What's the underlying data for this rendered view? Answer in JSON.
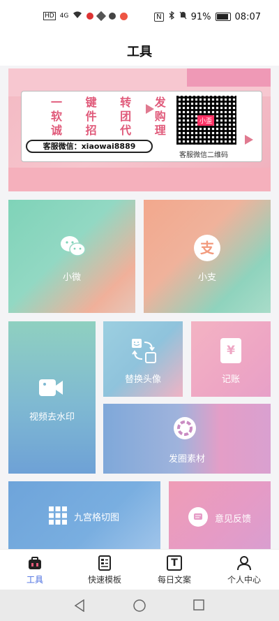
{
  "status_bar": {
    "left_icons": [
      "HD",
      "4G",
      "wifi-icon",
      "app-icon-1",
      "app-icon-2",
      "app-icon-3",
      "app-icon-4"
    ],
    "nfc_icon": "N",
    "battery": "91%",
    "time": "08:07"
  },
  "header": {
    "title": "工具"
  },
  "banner": {
    "slogan_lines": [
      "一 键 转 发",
      "软 件 团 购",
      "诚 招 代 理"
    ],
    "wechat_text": "客服微信：xiaowai8889",
    "qr_caption": "客服微信二维码",
    "qr_badge": "小歪"
  },
  "tiles": {
    "wechat": "小微",
    "alipay": "小支",
    "watermark": "视频去水印",
    "avatar": "替换头像",
    "ledger": "记账",
    "moments": "发圈素材",
    "grid": "九宫格切图",
    "feedback": "意见反馈",
    "alipay_glyph": "支",
    "ledger_glyph": "¥"
  },
  "bottom_nav": {
    "items": [
      "工具",
      "快速模板",
      "每日文案",
      "个人中心"
    ],
    "active_index": 0,
    "text_glyph": "T"
  },
  "colors": {
    "accent": "#4a6ee0",
    "mint": "#7fd3b8",
    "peach": "#f0a98b",
    "pink": "#e9a8c9",
    "blue": "#78a6d8"
  }
}
